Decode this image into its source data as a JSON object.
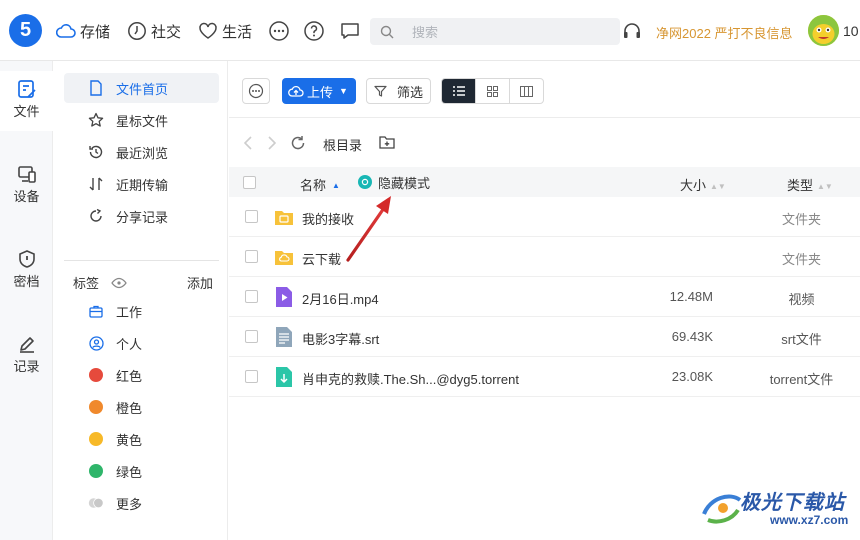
{
  "topbar": {
    "logo": "5",
    "nav": [
      "存储",
      "社交",
      "生活"
    ],
    "search_placeholder": "搜索",
    "notice": "净网2022 严打不良信息",
    "level": "10"
  },
  "rail": [
    {
      "label": "文件",
      "icon": "file-icon"
    },
    {
      "label": "设备",
      "icon": "device-icon"
    },
    {
      "label": "密档",
      "icon": "shield-icon"
    },
    {
      "label": "记录",
      "icon": "edit-icon"
    }
  ],
  "sidebar": {
    "items": [
      {
        "label": "文件首页",
        "icon": "document-icon"
      },
      {
        "label": "星标文件",
        "icon": "star-icon"
      },
      {
        "label": "最近浏览",
        "icon": "history-icon"
      },
      {
        "label": "近期传输",
        "icon": "transfer-icon"
      },
      {
        "label": "分享记录",
        "icon": "share-icon"
      }
    ],
    "tags_title": "标签",
    "tags_add": "添加",
    "tags": [
      {
        "label": "工作",
        "icon": "briefcase-icon"
      },
      {
        "label": "个人",
        "icon": "person-icon"
      },
      {
        "label": "红色",
        "color": "#e64a3c"
      },
      {
        "label": "橙色",
        "color": "#f0892c"
      },
      {
        "label": "黄色",
        "color": "#f7b928"
      },
      {
        "label": "绿色",
        "color": "#2fb56a"
      },
      {
        "label": "更多",
        "color": "#cfcfcf"
      }
    ]
  },
  "toolbar": {
    "upload": "上传",
    "filter": "筛选"
  },
  "path": {
    "root": "根目录"
  },
  "table": {
    "headers": {
      "name": "名称",
      "size": "大小",
      "type": "类型"
    },
    "hidden_mode": "隐藏模式",
    "rows": [
      {
        "name": "我的接收",
        "size": "",
        "type": "文件夹",
        "kind": "folder-special"
      },
      {
        "name": "云下载",
        "size": "",
        "type": "文件夹",
        "kind": "folder-cloud"
      },
      {
        "name": "2月16日.mp4",
        "size": "12.48M",
        "type": "视频",
        "kind": "video"
      },
      {
        "name": "电影3字幕.srt",
        "size": "69.43K",
        "type": "srt文件",
        "kind": "text"
      },
      {
        "name": "肖申克的救赎.The.Sh...@dyg5.torrent",
        "size": "23.08K",
        "type": "torrent文件",
        "kind": "torrent"
      }
    ]
  },
  "watermark": {
    "text": "极光下载站",
    "url": "www.xz7.com"
  },
  "colors": {
    "accent": "#1a6ee8",
    "notice": "#d79632",
    "hidden_mode": "#19b7b5",
    "annotation_arrow": "#d42a2a"
  }
}
